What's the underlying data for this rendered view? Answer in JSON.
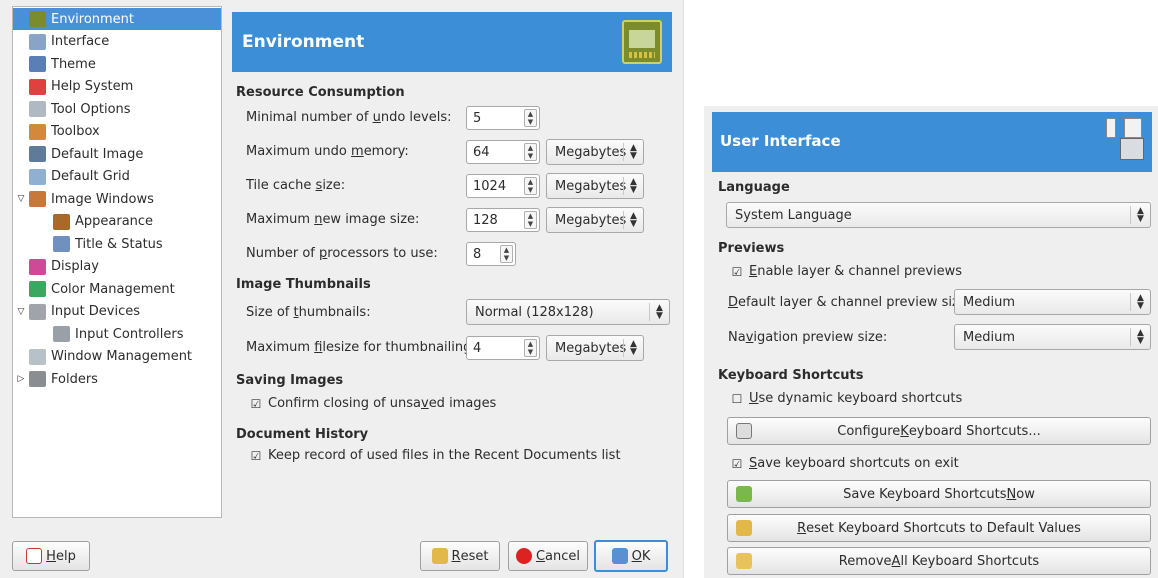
{
  "tree": {
    "items": [
      {
        "label": "Environment",
        "level": 0,
        "selected": true,
        "icon": "chip-icon"
      },
      {
        "label": "Interface",
        "level": 0,
        "icon": "interface-icon"
      },
      {
        "label": "Theme",
        "level": 0,
        "icon": "theme-icon"
      },
      {
        "label": "Help System",
        "level": 0,
        "icon": "lifebuoy-icon"
      },
      {
        "label": "Tool Options",
        "level": 0,
        "icon": "tool-options-icon"
      },
      {
        "label": "Toolbox",
        "level": 0,
        "icon": "toolbox-icon"
      },
      {
        "label": "Default Image",
        "level": 0,
        "icon": "default-image-icon"
      },
      {
        "label": "Default Grid",
        "level": 0,
        "icon": "grid-icon"
      },
      {
        "label": "Image Windows",
        "level": 0,
        "expander": "expanded",
        "icon": "image-windows-icon"
      },
      {
        "label": "Appearance",
        "level": 1,
        "icon": "appearance-icon"
      },
      {
        "label": "Title & Status",
        "level": 1,
        "icon": "title-status-icon"
      },
      {
        "label": "Display",
        "level": 0,
        "icon": "display-icon"
      },
      {
        "label": "Color Management",
        "level": 0,
        "icon": "color-management-icon"
      },
      {
        "label": "Input Devices",
        "level": 0,
        "expander": "expanded",
        "icon": "input-devices-icon"
      },
      {
        "label": "Input Controllers",
        "level": 1,
        "icon": "input-controllers-icon"
      },
      {
        "label": "Window Management",
        "level": 0,
        "icon": "window-management-icon"
      },
      {
        "label": "Folders",
        "level": 0,
        "expander": "collapsed",
        "icon": "folders-icon"
      }
    ]
  },
  "env": {
    "header_title": "Environment",
    "resource": {
      "title": "Resource Consumption",
      "undo_levels": {
        "pre": "Minimal number of ",
        "u": "u",
        "post": "ndo levels:",
        "value": "5"
      },
      "undo_memory": {
        "pre": "Maximum undo ",
        "u": "m",
        "post": "emory:",
        "value": "64",
        "unit": "Megabytes"
      },
      "tile_cache": {
        "pre": "Tile cache ",
        "u": "s",
        "post": "ize:",
        "value": "1024",
        "unit": "Megabytes"
      },
      "new_image_size": {
        "pre": "Maximum ",
        "u": "n",
        "post": "ew image size:",
        "value": "128",
        "unit": "Megabytes"
      },
      "processors": {
        "pre": "Number of ",
        "u": "p",
        "post": "rocessors to use:",
        "value": "8"
      }
    },
    "thumbnails": {
      "title": "Image Thumbnails",
      "size": {
        "pre": "Size of ",
        "u": "t",
        "post": "humbnails:",
        "value": "Normal (128x128)"
      },
      "filesize": {
        "pre": "Maximum ",
        "u": "f",
        "post": "ilesize for thumbnailing:",
        "value": "4",
        "unit": "Megabytes"
      }
    },
    "saving": {
      "title": "Saving Images",
      "confirm": {
        "pre": "Confirm closing of unsa",
        "u": "v",
        "post": "ed images",
        "checked": "☑"
      }
    },
    "history": {
      "title": "Document History",
      "keep": {
        "label": "Keep record of used files in the Recent Documents list",
        "checked": "☑"
      }
    },
    "buttons": {
      "help": {
        "u": "H",
        "post": "elp"
      },
      "reset": {
        "u": "R",
        "post": "eset"
      },
      "cancel": {
        "u": "C",
        "post": "ancel"
      },
      "ok": {
        "u": "O",
        "post": "K"
      }
    }
  },
  "ui": {
    "header_title": "User Interface",
    "language": {
      "title": "Language",
      "value": "System Language"
    },
    "previews": {
      "title": "Previews",
      "enable": {
        "u": "E",
        "post": "nable layer & channel previews",
        "checked": "☑"
      },
      "default_size": {
        "u": "D",
        "post": "efault layer & channel preview size:",
        "value": "Medium"
      },
      "nav_size": {
        "pre": "Na",
        "u": "v",
        "post": "igation preview size:",
        "value": "Medium"
      }
    },
    "shortcuts": {
      "title": "Keyboard Shortcuts",
      "dynamic": {
        "u": "U",
        "post": "se dynamic keyboard shortcuts",
        "checked": "☐"
      },
      "configure": {
        "pre": "Configure ",
        "u": "K",
        "post": "eyboard Shortcuts..."
      },
      "save_on_exit": {
        "u": "S",
        "post": "ave keyboard shortcuts on exit",
        "checked": "☑"
      },
      "save_now": {
        "pre": "Save Keyboard Shortcuts ",
        "u": "N",
        "post": "ow"
      },
      "reset": {
        "u": "R",
        "post": "eset Keyboard Shortcuts to Default Values"
      },
      "remove": {
        "pre": "Remove ",
        "u": "A",
        "post": "ll Keyboard Shortcuts"
      }
    }
  },
  "colors": {
    "header_blue": "#3c8fd6",
    "selection_blue": "#4a90d9"
  }
}
